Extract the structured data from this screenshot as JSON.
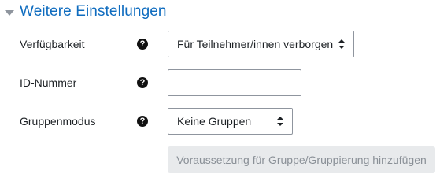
{
  "section": {
    "title": "Weitere Einstellungen",
    "expanded": true
  },
  "fields": {
    "availability": {
      "label": "Verfügbarkeit",
      "value": "Für Teilnehmer/innen verborgen",
      "help_icon": "question-circle-icon"
    },
    "id_number": {
      "label": "ID-Nummer",
      "value": "",
      "help_icon": "question-circle-icon"
    },
    "group_mode": {
      "label": "Gruppenmodus",
      "value": "Keine Gruppen",
      "help_icon": "question-circle-icon"
    }
  },
  "actions": {
    "add_restriction_label": "Voraussetzung für Gruppe/Gruppierung hinzufügen",
    "add_restriction_enabled": false
  },
  "colors": {
    "title": "#0f6cbf",
    "text": "#1d2125",
    "border": "#8f959e",
    "disabled_button_bg": "#e8eaec",
    "disabled_button_text": "#8a9097"
  }
}
